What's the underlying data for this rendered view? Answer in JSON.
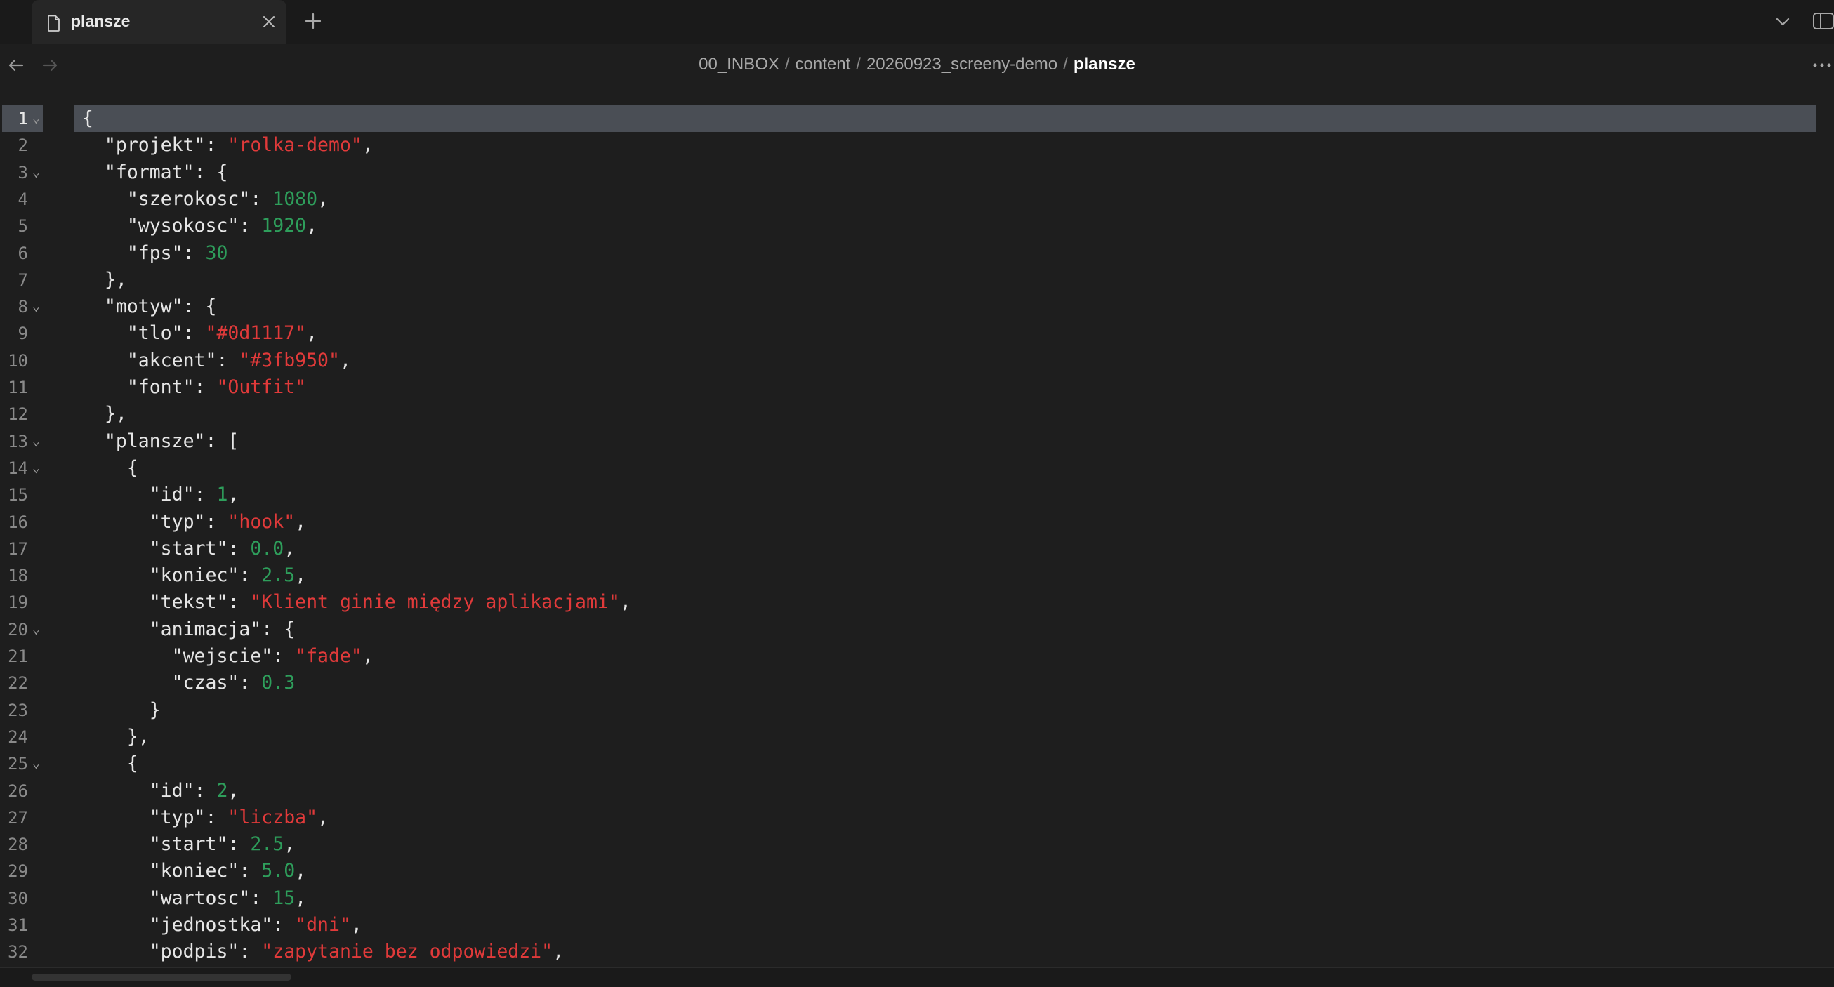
{
  "tab": {
    "title": "plansze"
  },
  "breadcrumb": [
    "00_INBOX",
    "content",
    "20260923_screeny-demo"
  ],
  "breadcrumb_current": "plansze",
  "breadcrumb_separator": "/",
  "colors": {
    "string": "#e03a3a",
    "number": "#2e9e5b",
    "text": "#e6e6e6",
    "active_line": "#4a4e55"
  },
  "editor": {
    "active_line": 1,
    "lines": [
      {
        "n": "1",
        "fold": true,
        "tokens": [
          [
            "p",
            "{"
          ]
        ]
      },
      {
        "n": "2",
        "fold": false,
        "tokens": [
          [
            "p",
            "  \"projekt\": "
          ],
          [
            "s",
            "\"rolka-demo\""
          ],
          [
            "p",
            ","
          ]
        ]
      },
      {
        "n": "3",
        "fold": true,
        "tokens": [
          [
            "p",
            "  \"format\": {"
          ]
        ]
      },
      {
        "n": "4",
        "fold": false,
        "tokens": [
          [
            "p",
            "    \"szerokosc\": "
          ],
          [
            "n",
            "1080"
          ],
          [
            "p",
            ","
          ]
        ]
      },
      {
        "n": "5",
        "fold": false,
        "tokens": [
          [
            "p",
            "    \"wysokosc\": "
          ],
          [
            "n",
            "1920"
          ],
          [
            "p",
            ","
          ]
        ]
      },
      {
        "n": "6",
        "fold": false,
        "tokens": [
          [
            "p",
            "    \"fps\": "
          ],
          [
            "n",
            "30"
          ]
        ]
      },
      {
        "n": "7",
        "fold": false,
        "tokens": [
          [
            "p",
            "  },"
          ]
        ]
      },
      {
        "n": "8",
        "fold": true,
        "tokens": [
          [
            "p",
            "  \"motyw\": {"
          ]
        ]
      },
      {
        "n": "9",
        "fold": false,
        "tokens": [
          [
            "p",
            "    \"tlo\": "
          ],
          [
            "s",
            "\"#0d1117\""
          ],
          [
            "p",
            ","
          ]
        ]
      },
      {
        "n": "10",
        "fold": false,
        "tokens": [
          [
            "p",
            "    \"akcent\": "
          ],
          [
            "s",
            "\"#3fb950\""
          ],
          [
            "p",
            ","
          ]
        ]
      },
      {
        "n": "11",
        "fold": false,
        "tokens": [
          [
            "p",
            "    \"font\": "
          ],
          [
            "s",
            "\"Outfit\""
          ]
        ]
      },
      {
        "n": "12",
        "fold": false,
        "tokens": [
          [
            "p",
            "  },"
          ]
        ]
      },
      {
        "n": "13",
        "fold": true,
        "tokens": [
          [
            "p",
            "  \"plansze\": ["
          ]
        ]
      },
      {
        "n": "14",
        "fold": true,
        "tokens": [
          [
            "p",
            "    {"
          ]
        ]
      },
      {
        "n": "15",
        "fold": false,
        "tokens": [
          [
            "p",
            "      \"id\": "
          ],
          [
            "n",
            "1"
          ],
          [
            "p",
            ","
          ]
        ]
      },
      {
        "n": "16",
        "fold": false,
        "tokens": [
          [
            "p",
            "      \"typ\": "
          ],
          [
            "s",
            "\"hook\""
          ],
          [
            "p",
            ","
          ]
        ]
      },
      {
        "n": "17",
        "fold": false,
        "tokens": [
          [
            "p",
            "      \"start\": "
          ],
          [
            "n",
            "0.0"
          ],
          [
            "p",
            ","
          ]
        ]
      },
      {
        "n": "18",
        "fold": false,
        "tokens": [
          [
            "p",
            "      \"koniec\": "
          ],
          [
            "n",
            "2.5"
          ],
          [
            "p",
            ","
          ]
        ]
      },
      {
        "n": "19",
        "fold": false,
        "tokens": [
          [
            "p",
            "      \"tekst\": "
          ],
          [
            "s",
            "\"Klient ginie między aplikacjami\""
          ],
          [
            "p",
            ","
          ]
        ]
      },
      {
        "n": "20",
        "fold": true,
        "tokens": [
          [
            "p",
            "      \"animacja\": {"
          ]
        ]
      },
      {
        "n": "21",
        "fold": false,
        "tokens": [
          [
            "p",
            "        \"wejscie\": "
          ],
          [
            "s",
            "\"fade\""
          ],
          [
            "p",
            ","
          ]
        ]
      },
      {
        "n": "22",
        "fold": false,
        "tokens": [
          [
            "p",
            "        \"czas\": "
          ],
          [
            "n",
            "0.3"
          ]
        ]
      },
      {
        "n": "23",
        "fold": false,
        "tokens": [
          [
            "p",
            "      }"
          ]
        ]
      },
      {
        "n": "24",
        "fold": false,
        "tokens": [
          [
            "p",
            "    },"
          ]
        ]
      },
      {
        "n": "25",
        "fold": true,
        "tokens": [
          [
            "p",
            "    {"
          ]
        ]
      },
      {
        "n": "26",
        "fold": false,
        "tokens": [
          [
            "p",
            "      \"id\": "
          ],
          [
            "n",
            "2"
          ],
          [
            "p",
            ","
          ]
        ]
      },
      {
        "n": "27",
        "fold": false,
        "tokens": [
          [
            "p",
            "      \"typ\": "
          ],
          [
            "s",
            "\"liczba\""
          ],
          [
            "p",
            ","
          ]
        ]
      },
      {
        "n": "28",
        "fold": false,
        "tokens": [
          [
            "p",
            "      \"start\": "
          ],
          [
            "n",
            "2.5"
          ],
          [
            "p",
            ","
          ]
        ]
      },
      {
        "n": "29",
        "fold": false,
        "tokens": [
          [
            "p",
            "      \"koniec\": "
          ],
          [
            "n",
            "5.0"
          ],
          [
            "p",
            ","
          ]
        ]
      },
      {
        "n": "30",
        "fold": false,
        "tokens": [
          [
            "p",
            "      \"wartosc\": "
          ],
          [
            "n",
            "15"
          ],
          [
            "p",
            ","
          ]
        ]
      },
      {
        "n": "31",
        "fold": false,
        "tokens": [
          [
            "p",
            "      \"jednostka\": "
          ],
          [
            "s",
            "\"dni\""
          ],
          [
            "p",
            ","
          ]
        ]
      },
      {
        "n": "32",
        "fold": false,
        "tokens": [
          [
            "p",
            "      \"podpis\": "
          ],
          [
            "s",
            "\"zapytanie bez odpowiedzi\""
          ],
          [
            "p",
            ","
          ]
        ]
      }
    ]
  }
}
